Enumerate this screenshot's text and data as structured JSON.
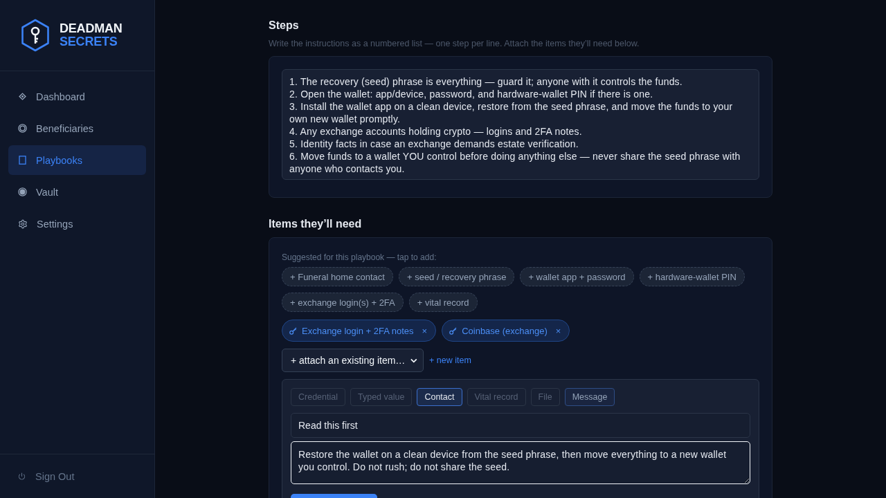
{
  "sidebar": {
    "logo": {
      "line_1": "DEADMAN",
      "line_2": "SECRETS"
    },
    "nav": [
      {
        "label": "Dashboard",
        "selected": false
      },
      {
        "label": "Beneficiaries",
        "selected": false
      },
      {
        "label": "Playbooks",
        "selected": true
      },
      {
        "label": "Vault",
        "selected": false
      },
      {
        "label": "Settings",
        "selected": false
      }
    ],
    "sign_out": "Sign Out"
  },
  "steps": {
    "title": "Steps",
    "hint": "Write the instructions as a numbered list — one step per line. Attach the items they’ll need below.",
    "value": "1. The recovery (seed) phrase is everything — guard it; anyone with it controls the funds.\n2. Open the wallet: app/device, password, and hardware-wallet PIN if there is one.\n3. Install the wallet app on a clean device, restore from the seed phrase, and move the funds to your own new wallet promptly.\n4. Any exchange accounts holding crypto — logins and 2FA notes.\n5. Identity facts in case an exchange demands estate verification.\n6. Move funds to a wallet YOU control before doing anything else — never share the seed phrase with anyone who contacts you."
  },
  "items": {
    "title": "Items they’ll need",
    "suggested_label": "Suggested for this playbook — tap to add:",
    "suggestions": [
      "+ Funeral home contact",
      "+ seed / recovery phrase",
      "+ wallet app + password",
      "+ hardware-wallet PIN",
      "+ exchange login(s) + 2FA",
      "+ vital record"
    ],
    "attached": [
      {
        "label": "Exchange login + 2FA notes",
        "remove": "×"
      },
      {
        "label": "Coinbase (exchange)",
        "remove": "×"
      }
    ],
    "attach_select": {
      "value": "+ attach an existing item…"
    },
    "new_item_link": "+ new item",
    "editor": {
      "types": [
        {
          "label": "Credential",
          "selected": false,
          "disabled": true
        },
        {
          "label": "Typed value",
          "selected": false,
          "disabled": true
        },
        {
          "label": "Contact",
          "selected": true,
          "disabled": false
        },
        {
          "label": "Vital record",
          "selected": false,
          "disabled": true
        },
        {
          "label": "File",
          "selected": false,
          "disabled": true
        },
        {
          "label": "Message",
          "selected": false,
          "disabled": false
        }
      ],
      "title_field": {
        "value": "Read this first"
      },
      "message_field": {
        "value": "Restore the wallet on a clean device from the seed phrase, then move everything to a new wallet you control. Do not rush; do not share the seed.",
        "focused": true
      }
    }
  }
}
